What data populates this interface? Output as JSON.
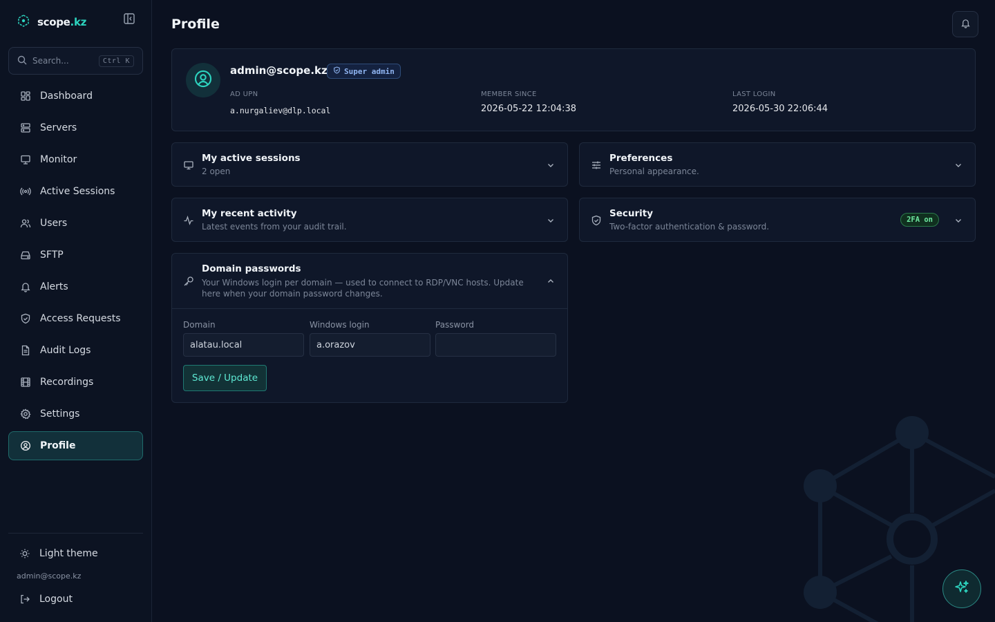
{
  "brand": {
    "name": "scope",
    "tld": ".kz"
  },
  "search": {
    "placeholder": "Search...",
    "shortcut": "Ctrl K"
  },
  "sidebar": {
    "items": [
      {
        "label": "Dashboard",
        "icon": "dashboard-icon"
      },
      {
        "label": "Servers",
        "icon": "server-icon"
      },
      {
        "label": "Monitor",
        "icon": "monitor-icon"
      },
      {
        "label": "Active Sessions",
        "icon": "broadcast-icon"
      },
      {
        "label": "Users",
        "icon": "users-icon"
      },
      {
        "label": "SFTP",
        "icon": "drive-icon"
      },
      {
        "label": "Alerts",
        "icon": "bell-icon"
      },
      {
        "label": "Access Requests",
        "icon": "shield-check-icon"
      },
      {
        "label": "Audit Logs",
        "icon": "file-text-icon"
      },
      {
        "label": "Recordings",
        "icon": "film-icon"
      },
      {
        "label": "Settings",
        "icon": "gear-icon"
      },
      {
        "label": "Profile",
        "icon": "user-circle-icon",
        "active": true
      }
    ],
    "theme_toggle": "Light theme",
    "user_email": "admin@scope.kz",
    "logout": "Logout"
  },
  "page": {
    "title": "Profile"
  },
  "profile": {
    "name": "admin@scope.kz",
    "role": "Super admin",
    "ad_upn_label": "AD UPN",
    "ad_upn": "a.nurgaliev@dlp.local",
    "member_since_label": "MEMBER SINCE",
    "member_since": "2026-05-22 12:04:38",
    "last_login_label": "LAST LOGIN",
    "last_login": "2026-05-30 22:06:44"
  },
  "sections": {
    "sessions": {
      "title": "My active sessions",
      "subtitle": "2 open"
    },
    "preferences": {
      "title": "Preferences",
      "subtitle": "Personal appearance."
    },
    "activity": {
      "title": "My recent activity",
      "subtitle": "Latest events from your audit trail."
    },
    "security": {
      "title": "Security",
      "subtitle": "Two-factor authentication & password.",
      "badge": "2FA on"
    },
    "domain": {
      "title": "Domain passwords",
      "subtitle": "Your Windows login per domain — used to connect to RDP/VNC hosts. Update here when your domain password changes.",
      "domain_label": "Domain",
      "domain_value": "alatau.local",
      "login_label": "Windows login",
      "login_value": "a.orazov",
      "password_label": "Password",
      "password_value": "",
      "save_label": "Save / Update"
    }
  },
  "colors": {
    "accent": "#2dd4bf",
    "background": "#0b1120",
    "card": "#0f1729",
    "badge_blue": "#8fb4f0",
    "badge_green": "#6ee7a0"
  }
}
